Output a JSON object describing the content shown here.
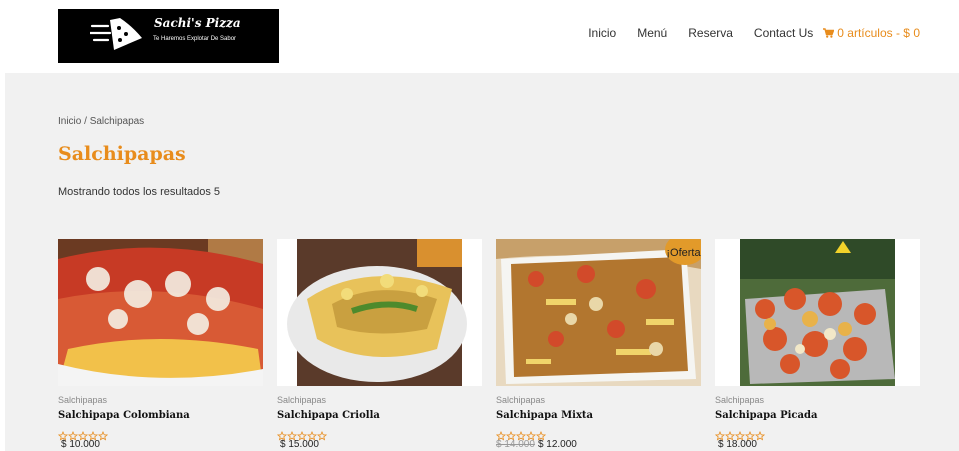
{
  "header": {
    "logo_title": "Sachi's Pizza",
    "logo_tagline": "Te Haremos Explotar De Sabor",
    "nav": [
      "Inicio",
      "Menú",
      "Reserva",
      "Contact Us"
    ],
    "cart_label": "0 artículos - $ 0"
  },
  "breadcrumb": {
    "home": "Inicio",
    "separator": " / ",
    "current": "Salchipapas"
  },
  "page_title": "Salchipapas",
  "result_count": "Mostrando todos los resultados 5",
  "products": [
    {
      "category": "Salchipapas",
      "name": "Salchipapa Colombiana",
      "price": "$ 10.000",
      "old_price": "",
      "badge": "",
      "rating": 0
    },
    {
      "category": "Salchipapas",
      "name": "Salchipapa Criolla",
      "price": "$ 15.000",
      "old_price": "",
      "badge": "",
      "rating": 0
    },
    {
      "category": "Salchipapas",
      "name": "Salchipapa Mixta",
      "price": "$ 12.000",
      "old_price": "$ 14.000",
      "badge": "¡Oferta!",
      "rating": 0
    },
    {
      "category": "Salchipapas",
      "name": "Salchipapa Picada",
      "price": "$ 18.000",
      "old_price": "",
      "badge": "",
      "rating": 0
    }
  ],
  "colors": {
    "accent": "#e88c1c",
    "background": "#f1f1f1",
    "badge": "#e29a2a"
  }
}
